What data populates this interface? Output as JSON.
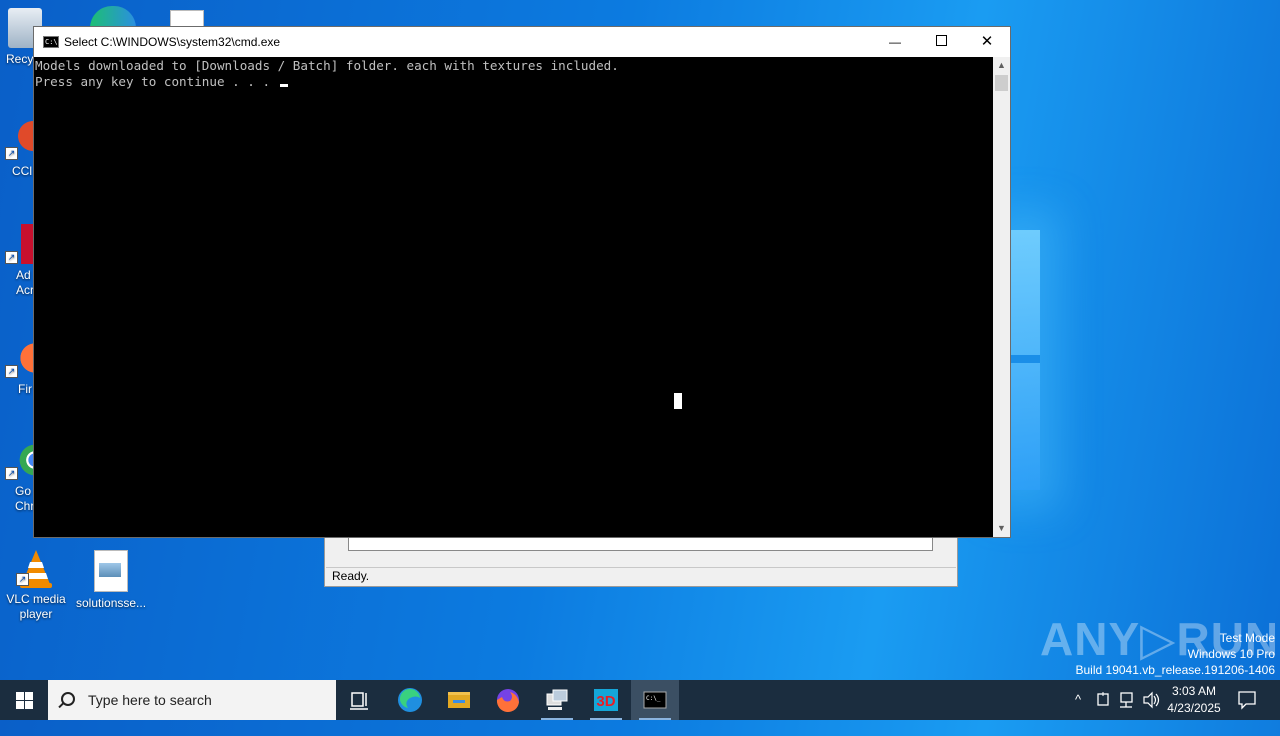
{
  "desktop": {
    "icons": [
      {
        "label": "Recy"
      },
      {
        "label": "CCl"
      },
      {
        "label": "Ad\nAcr"
      },
      {
        "label": "Fir"
      },
      {
        "label": "Go\nChr"
      },
      {
        "label": "VLC media player"
      },
      {
        "label": "solutionsse..."
      }
    ]
  },
  "background_window": {
    "status_text": "Ready."
  },
  "cmd_window": {
    "title": "Select C:\\WINDOWS\\system32\\cmd.exe",
    "icon_text": "C:\\",
    "lines": [
      "Models downloaded to [Downloads / Batch] folder. each with textures included.",
      "Press any key to continue . . . "
    ],
    "controls": {
      "minimize": "—",
      "close": "✕"
    }
  },
  "watermark": {
    "text": "ANY▷RUN"
  },
  "system_info": {
    "line1": "Test Mode",
    "line2": "Windows 10 Pro",
    "line3": "Build 19041.vb_release.191206-1406"
  },
  "taskbar": {
    "search_placeholder": "Type here to search",
    "clock_time": "3:03 AM",
    "clock_date": "4/23/2025",
    "tray_chevron": "^"
  },
  "colors": {
    "taskbar_bg": "#1b2d3f",
    "console_bg": "#000000",
    "console_text": "#c0c0c0"
  }
}
